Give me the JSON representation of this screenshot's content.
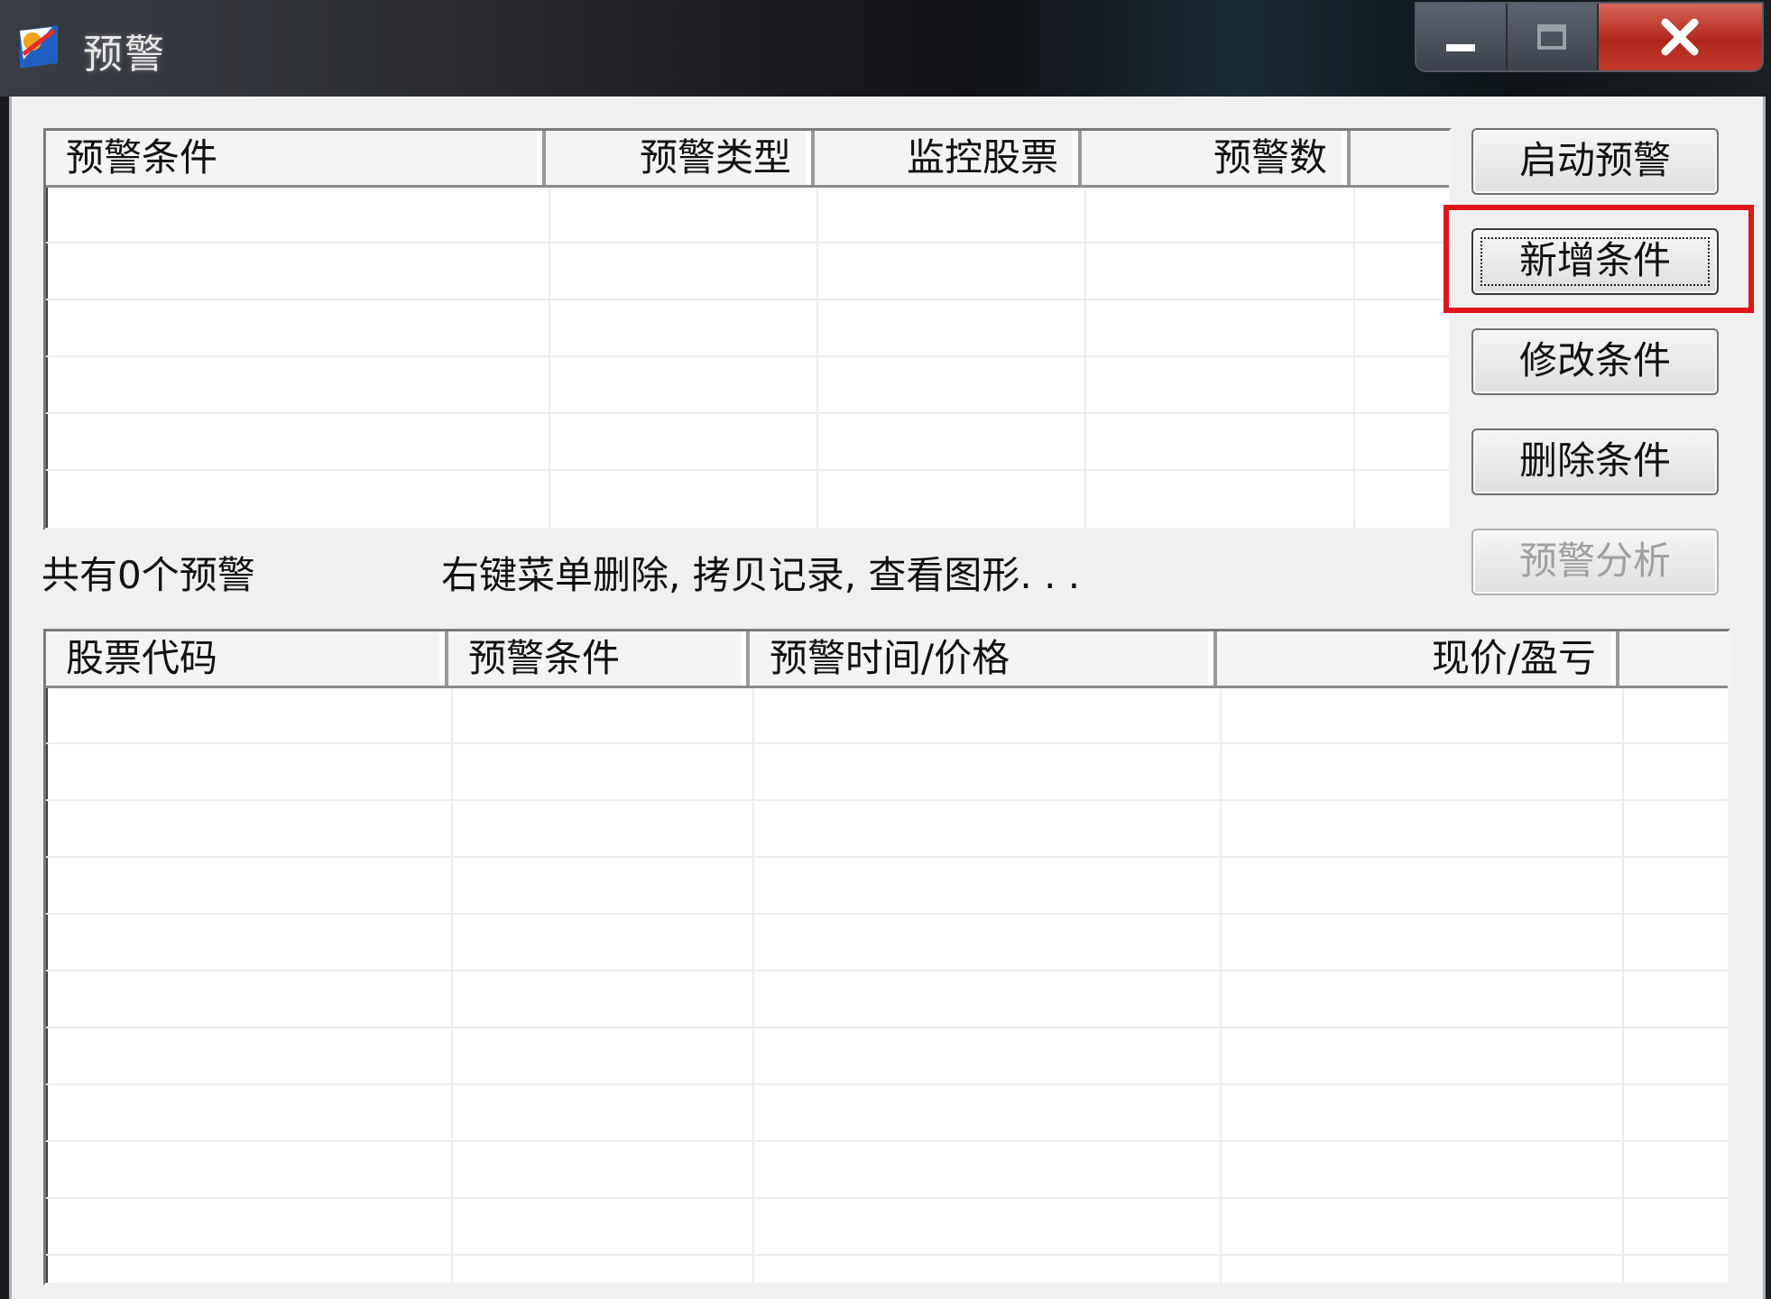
{
  "window": {
    "title": "预警"
  },
  "alert_list": {
    "columns": [
      "预警条件",
      "预警类型",
      "监控股票",
      "预警数"
    ]
  },
  "buttons": {
    "start": "启动预警",
    "add": "新增条件",
    "modify": "修改条件",
    "delete": "删除条件",
    "analyze": "预警分析"
  },
  "status": {
    "count_text": "共有0个预警",
    "hint_text": "右键菜单删除, 拷贝记录, 查看图形. . ."
  },
  "record_list": {
    "columns": [
      "股票代码",
      "预警条件",
      "预警时间/价格",
      "现价/盈亏"
    ]
  },
  "colors": {
    "highlight": "#e0141c"
  }
}
